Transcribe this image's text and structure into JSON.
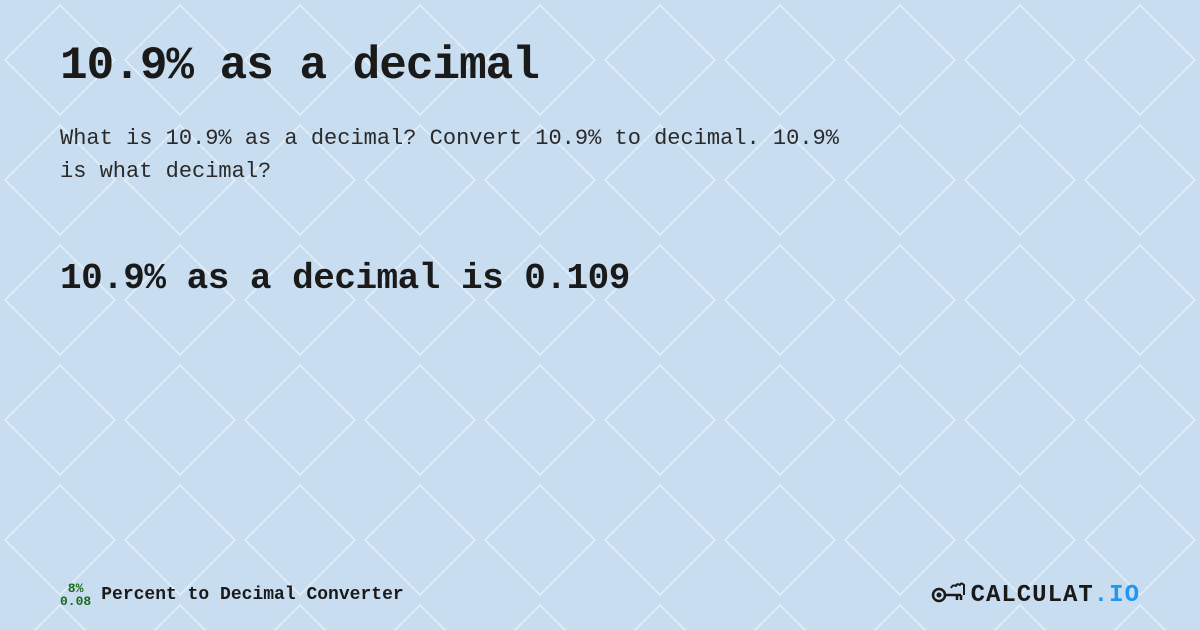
{
  "page": {
    "title": "10.9% as a decimal",
    "description": "What is 10.9% as a decimal? Convert 10.9% to decimal. 10.9% is what decimal?",
    "result": "10.9% as a decimal is 0.109"
  },
  "footer": {
    "percent_top": "8%",
    "percent_bottom": "0.08",
    "label": "Percent to Decimal Converter",
    "logo_text": "CALCULAT",
    "logo_suffix": ".IO"
  },
  "background": {
    "color": "#c8ddf0"
  }
}
